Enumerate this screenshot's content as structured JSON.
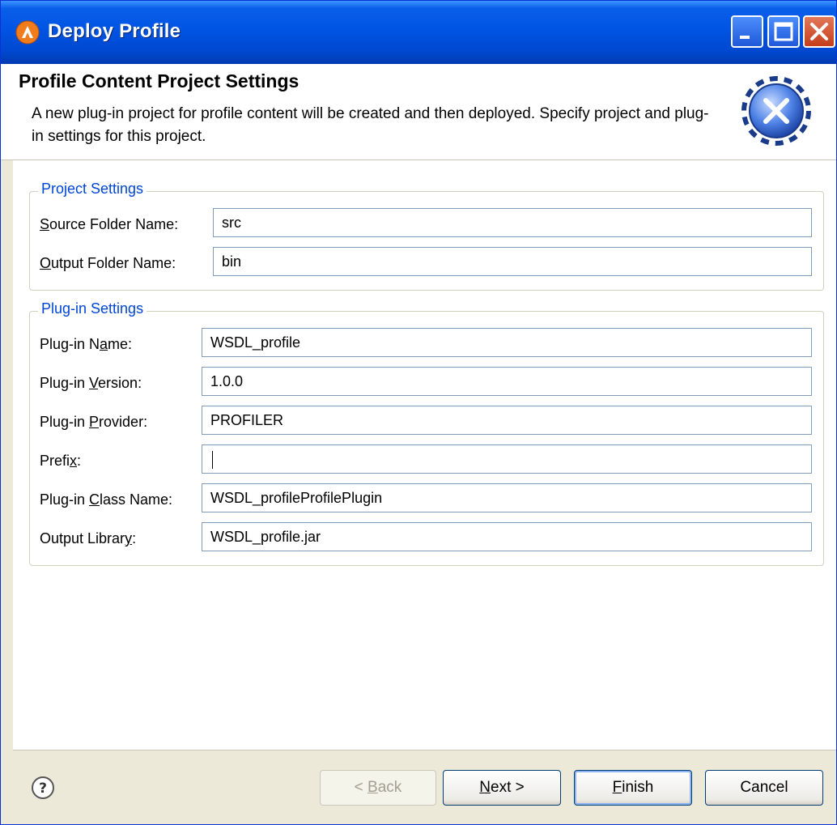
{
  "window": {
    "title": "Deploy Profile"
  },
  "banner": {
    "title": "Profile Content Project Settings",
    "description": "A new plug-in project for profile content will be created and then deployed. Specify project and plug-in settings for this project."
  },
  "project_settings": {
    "title": "Project Settings",
    "source_folder": {
      "label_pre": "",
      "label_key": "S",
      "label_post": "ource Folder Name:",
      "value": "src"
    },
    "output_folder": {
      "label_pre": "",
      "label_key": "O",
      "label_post": "utput Folder Name:",
      "value": "bin"
    }
  },
  "plugin_settings": {
    "title": "Plug-in Settings",
    "name": {
      "label_pre": "Plug-in N",
      "label_key": "a",
      "label_post": "me:",
      "value": "WSDL_profile"
    },
    "version": {
      "label_pre": "Plug-in ",
      "label_key": "V",
      "label_post": "ersion:",
      "value": "1.0.0"
    },
    "provider": {
      "label_pre": "Plug-in ",
      "label_key": "P",
      "label_post": "rovider:",
      "value": "PROFILER"
    },
    "prefix": {
      "label_pre": "Prefi",
      "label_key": "x",
      "label_post": ":",
      "value": ""
    },
    "class_name": {
      "label_pre": "Plug-in ",
      "label_key": "C",
      "label_post": "lass Name:",
      "value": "WSDL_profileProfilePlugin"
    },
    "output_library": {
      "label_pre": "Output Librar",
      "label_key": "y",
      "label_post": ":",
      "value": "WSDL_profile.jar"
    }
  },
  "buttons": {
    "back": {
      "pre": "< ",
      "key": "B",
      "post": "ack"
    },
    "next": {
      "pre": "",
      "key": "N",
      "post": "ext >"
    },
    "finish": {
      "pre": "",
      "key": "F",
      "post": "inish"
    },
    "cancel": {
      "label": "Cancel"
    }
  },
  "colors": {
    "titlebar": "#0054e3",
    "group_title": "#0046d5",
    "close_button": "#c53e1a"
  },
  "icons": {
    "title": "app-logo-icon",
    "banner": "wizard-gear-icon",
    "help": "help-icon"
  }
}
